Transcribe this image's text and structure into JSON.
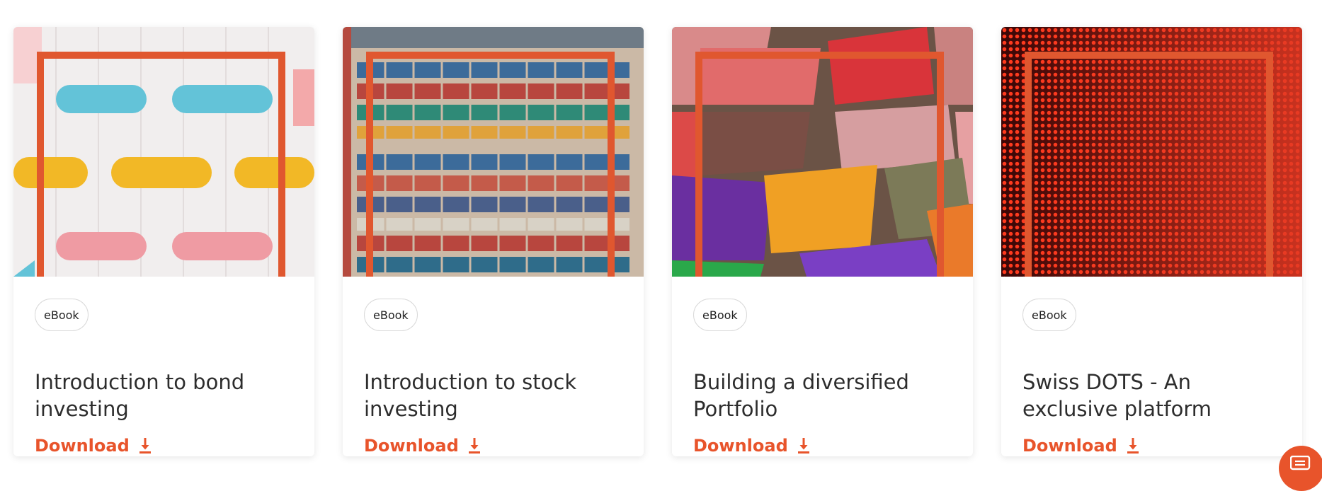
{
  "cards": [
    {
      "tag": "eBook",
      "title": "Introduction to bond investing",
      "download_label": "Download",
      "image_subject": "aerial view of colored tanks",
      "accent_color": "#e0572f"
    },
    {
      "tag": "eBook",
      "title": "Introduction to stock investing",
      "download_label": "Download",
      "image_subject": "aerial view of shipping containers",
      "accent_color": "#e0572f"
    },
    {
      "tag": "eBook",
      "title": "Building a diversified Portfolio",
      "download_label": "Download",
      "image_subject": "boxes of colored pigment powders",
      "accent_color": "#e0572f"
    },
    {
      "tag": "eBook",
      "title": "Swiss DOTS - An exclusive platform",
      "download_label": "Download",
      "image_subject": "red LED dot wall",
      "accent_color": "#e0572f"
    }
  ],
  "colors": {
    "brand": "#e8542b",
    "text": "#2d2d2d",
    "tag_border": "#d9d9d9"
  },
  "icons": {
    "download": "download-icon",
    "chat": "chat-icon"
  }
}
